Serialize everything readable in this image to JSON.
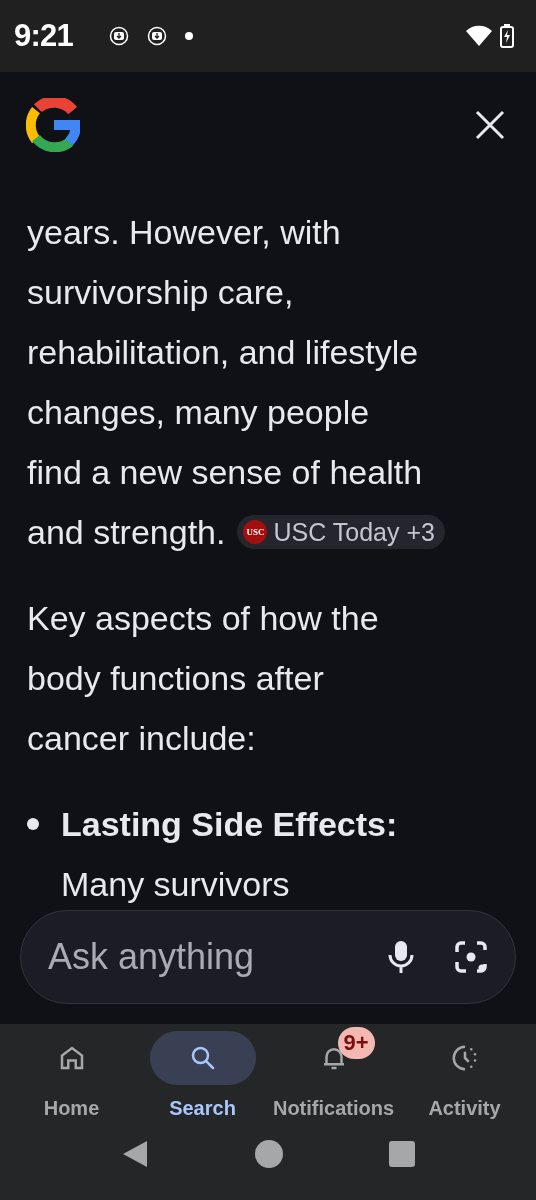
{
  "status_bar": {
    "time": "9:21"
  },
  "answer": {
    "paragraphs": [
      {
        "lines": [
          "years. However, with",
          "survivorship care,",
          "rehabilitation, and lifestyle",
          "changes, many people",
          "find a new sense of health",
          "and strength."
        ],
        "source_chip": {
          "label": "USC Today +3",
          "logo": "USC"
        }
      },
      {
        "lines": [
          "Key aspects of how the",
          "body functions after",
          "cancer include:"
        ]
      }
    ],
    "bullets": [
      "**Lasting Side Effects:** Many survivors"
    ]
  },
  "search": {
    "placeholder": "Ask anything"
  },
  "nav": [
    {
      "label": "Home",
      "kind": "home",
      "selected": false
    },
    {
      "label": "Search",
      "kind": "search",
      "selected": true
    },
    {
      "label": "Notifications",
      "kind": "bell",
      "selected": false,
      "badge": "9+"
    },
    {
      "label": "Activity",
      "kind": "activity",
      "selected": false
    }
  ]
}
